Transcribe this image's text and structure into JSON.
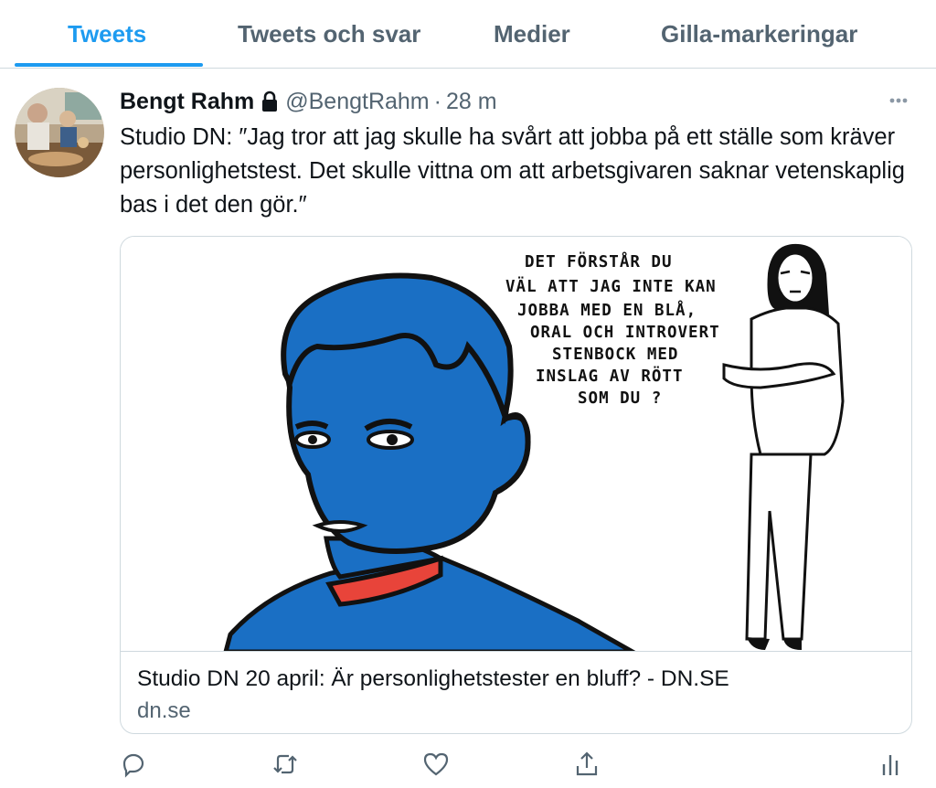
{
  "tabs": [
    {
      "label": "Tweets",
      "active": true
    },
    {
      "label": "Tweets och svar",
      "active": false
    },
    {
      "label": "Medier",
      "active": false
    },
    {
      "label": "Gilla-markeringar",
      "active": false
    }
  ],
  "tweet": {
    "author_name": "Bengt Rahm",
    "locked": true,
    "handle": "@BengtRahm",
    "separator": "·",
    "time": "28 m",
    "text": "Studio DN: ″Jag tror att jag skulle ha svårt att jobba på ett ställe som kräver personlighetstest. Det skulle vittna om att arbetsgivaren saknar vetenskaplig bas i det den gör.″",
    "card": {
      "title": "Studio DN 20 april: Är personlighetstester en bluff? - DN.SE",
      "domain": "dn.se",
      "speech_lines": [
        "DET FÖRSTÅR DU",
        "VÄL ATT JAG INTE KAN",
        "JOBBA MED EN BLÅ,",
        "ORAL OCH INTROVERT",
        "STENBOCK MED",
        "INSLAG AV RÖTT",
        "SOM DU ?"
      ]
    },
    "actions": [
      "reply-icon",
      "retweet-icon",
      "like-icon",
      "share-icon",
      "analytics-icon"
    ]
  },
  "colors": {
    "accent": "#1d9bf0",
    "secondary_text": "#536471",
    "illustration_blue": "#1a6fc4",
    "illustration_red": "#e8443a"
  }
}
